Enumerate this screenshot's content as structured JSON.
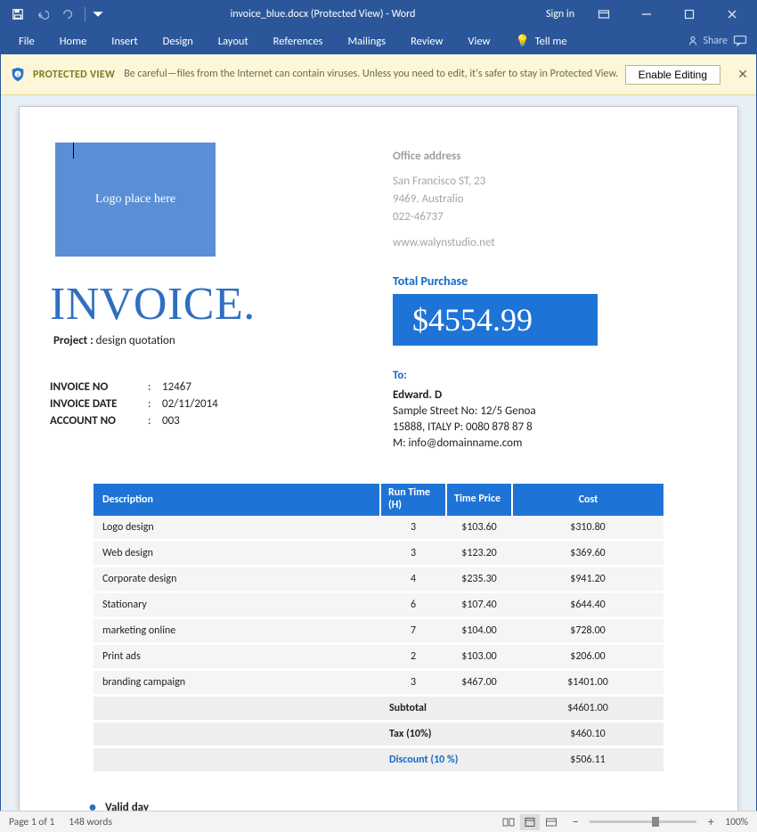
{
  "window": {
    "title": "invoice_blue.docx (Protected View) - Word",
    "signin": "Sign in"
  },
  "ribbon": {
    "tabs": [
      "File",
      "Home",
      "Insert",
      "Design",
      "Layout",
      "References",
      "Mailings",
      "Review",
      "View"
    ],
    "tellme": "Tell me",
    "share": "Share"
  },
  "banner": {
    "title": "PROTECTED VIEW",
    "message": "Be careful—files from the Internet can contain viruses. Unless you need to edit, it's safer to stay in Protected View.",
    "enable": "Enable Editing"
  },
  "doc": {
    "logo_placeholder": "Logo place here",
    "office": {
      "heading": "Office address",
      "line1": "San Francisco ST, 23",
      "line2": "9469. Australio",
      "phone": "022-46737",
      "web": "www.walynstudio.net"
    },
    "invoice_title": "INVOICE.",
    "project_label": "Project :",
    "project_value": "design quotation",
    "meta": {
      "invoice_no_label": "INVOICE NO",
      "invoice_no": "12467",
      "invoice_date_label": "INVOICE DATE",
      "invoice_date": "02/11/2014",
      "account_no_label": "ACCOUNT NO",
      "account_no": "003"
    },
    "total_label": "Total Purchase",
    "total_value": "$4554.99",
    "to_label": "To:",
    "to": {
      "name": "Edward. D",
      "street": "Sample Street No: 12/5 Genoa",
      "cityphone": "15888, ITALY P: 0080 878 87 8",
      "email": "M: info@domainname.com"
    },
    "table": {
      "headers": {
        "desc": "Description",
        "runtime": "Run Time (H)",
        "timeprice": "Time Price",
        "cost": "Cost"
      },
      "items": [
        {
          "desc": "Logo design",
          "rt": "3",
          "tp": "$103.60",
          "cost": "$310.80"
        },
        {
          "desc": "Web design",
          "rt": "3",
          "tp": "$123.20",
          "cost": "$369.60"
        },
        {
          "desc": "Corporate design",
          "rt": "4",
          "tp": "$235.30",
          "cost": "$941.20"
        },
        {
          "desc": "Stationary",
          "rt": "6",
          "tp": "$107.40",
          "cost": "$644.40"
        },
        {
          "desc": "marketing online",
          "rt": "7",
          "tp": "$104.00",
          "cost": "$728.00"
        },
        {
          "desc": "Print ads",
          "rt": "2",
          "tp": "$103.00",
          "cost": "$206.00"
        },
        {
          "desc": "branding campaign",
          "rt": "3",
          "tp": "$467.00",
          "cost": "$1401.00"
        }
      ],
      "subtotal_label": "Subtotal",
      "subtotal": "$4601.00",
      "tax_label": "Tax (10%)",
      "tax": "$460.10",
      "discount_label": "Discount (10 %)",
      "discount": "$506.11"
    },
    "valid_day": "Valid day"
  },
  "status": {
    "page": "Page 1 of 1",
    "words": "148 words",
    "zoom": "100%"
  }
}
